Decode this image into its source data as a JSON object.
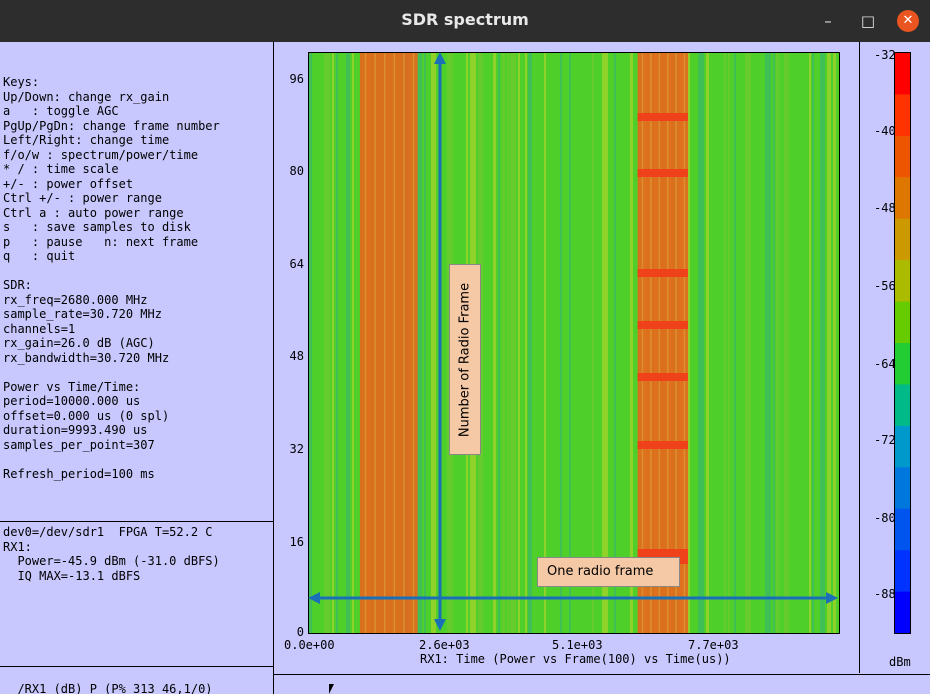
{
  "window": {
    "title": "SDR spectrum",
    "minimize_glyph": "–",
    "maximize_glyph": "□",
    "close_glyph": "✕",
    "close_color": "#e95420"
  },
  "left_panel": {
    "keys_text": "Keys:\nUp/Down: change rx_gain\na   : toggle AGC\nPgUp/PgDn: change frame number\nLeft/Right: change time\nf/o/w : spectrum/power/time\n* / : time scale\n+/- : power offset\nCtrl +/- : power range\nCtrl a : auto power range\ns   : save samples to disk\np   : pause   n: next frame\nq   : quit\n\nSDR:\nrx_freq=2680.000 MHz\nsample_rate=30.720 MHz\nchannels=1\nrx_gain=26.0 dB (AGC)\nrx_bandwidth=30.720 MHz\n\nPower vs Time/Time:\nperiod=10000.000 us\noffset=0.000 us (0 spl)\nduration=9993.490 us\nsamples_per_point=307\n\nRefresh_period=100 ms",
    "status_text": "dev0=/dev/sdr1  FPGA T=52.2 C\nRX1:\n  Power=-45.9 dBm (-31.0 dBFS)\n  IQ MAX=-13.1 dBFS",
    "bottom_text": "  /RX1 (dB) P (P% 313 46,1/0)"
  },
  "chart_data": {
    "type": "heatmap",
    "xlabel": "RX1: Time (Power vs Frame(100) vs Time(us))",
    "x_ticks": [
      "0.0e+00",
      "2.6e+03",
      "5.1e+03",
      "7.7e+03"
    ],
    "x_tick_values": [
      0,
      2600,
      5100,
      7700
    ],
    "xlim": [
      0,
      10000
    ],
    "y_ticks": [
      "0",
      "16",
      "32",
      "48",
      "64",
      "80",
      "96"
    ],
    "y_tick_values": [
      0,
      16,
      32,
      48,
      64,
      80,
      96
    ],
    "ylim": [
      0,
      100
    ],
    "colorbar": {
      "label": "dBm",
      "ticks": [
        "-32",
        "-40",
        "-48",
        "-56",
        "-64",
        "-72",
        "-80",
        "-88"
      ],
      "tick_values": [
        -32,
        -40,
        -48,
        -56,
        -64,
        -72,
        -80,
        -88
      ],
      "range": [
        -94,
        -30
      ]
    },
    "band_intervals_us": [
      [
        960,
        2050
      ],
      [
        6200,
        7150
      ]
    ],
    "band_level_dbm": -42,
    "background_level_dbm": -58
  },
  "annotations": {
    "vertical_label": "Number of Radio Frame",
    "horizontal_label": "One radio frame",
    "arrow_color": "#1a6fb8",
    "box_color": "#f5c9a5"
  },
  "colors": {
    "panel_bg": "#c8c8ff",
    "titlebar_bg": "#2d2d2d",
    "heatmap_green": "#4fcf2a",
    "heatmap_orange": "#e8651c"
  }
}
